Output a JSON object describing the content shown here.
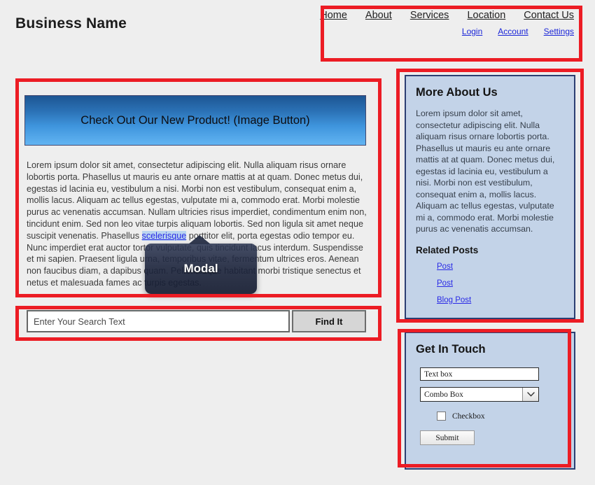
{
  "header": {
    "business_name": "Business Name"
  },
  "nav": {
    "primary": [
      {
        "label": "Home"
      },
      {
        "label": "About"
      },
      {
        "label": "Services"
      },
      {
        "label": "Location"
      },
      {
        "label": "Contact Us"
      }
    ],
    "secondary": [
      {
        "label": "Login"
      },
      {
        "label": "Account"
      },
      {
        "label": "Settings"
      }
    ]
  },
  "main": {
    "hero_button_label": "Check Out Our New Product! (Image Button)",
    "body_text_before_link": "Lorem ipsum dolor sit amet, consectetur adipiscing elit. Nulla aliquam risus ornare lobortis porta. Phasellus ut mauris eu ante ornare mattis at at quam. Donec metus dui, egestas id lacinia eu, vestibulum a nisi. Morbi non est vestibulum, consequat enim a, mollis lacus. Aliquam ac tellus egestas, vulputate mi a, commodo erat. Morbi molestie purus ac venenatis accumsan. Nullam ultricies risus imperdiet, condimentum enim non, tincidunt enim. Sed non leo vitae turpis aliquam lobortis. Sed non ligula sit amet neque suscipit venenatis. Phasellus ",
    "body_link_text": "scelerisque",
    "body_text_after_link": " porttitor elit, porta egestas odio tempor eu. Nunc imperdiet erat auctor tortor vulputate, quis tincidunt lacus interdum. Suspendisse et mi sapien. Praesent ligula urna, temporibus vitae, fermentum ultrices eros. Aenean non faucibus diam, a dapibus quam. Pellentesque habitant morbi tristique senectus et netus et malesuada fames ac turpis egestas."
  },
  "modal": {
    "label": "Modal"
  },
  "search": {
    "placeholder": "Enter Your Search Text",
    "value": "",
    "button_label": "Find It"
  },
  "sidebar": {
    "about": {
      "heading": "More About Us",
      "text": "Lorem ipsum dolor sit amet, consectetur adipiscing elit. Nulla aliquam risus ornare lobortis porta. Phasellus ut mauris eu ante ornare mattis at at quam. Donec metus dui, egestas id lacinia eu, vestibulum a nisi. Morbi non est vestibulum, consequat enim a, mollis lacus. Aliquam ac tellus egestas, vulputate mi a, commodo erat. Morbi molestie purus ac venenatis accumsan.",
      "related_heading": "Related Posts",
      "related_links": [
        {
          "label": "Post"
        },
        {
          "label": "Post"
        },
        {
          "label": "Blog Post"
        }
      ]
    },
    "contact": {
      "heading": "Get In Touch",
      "textbox_value": "Text box",
      "textbox_placeholder": "Text box",
      "combobox_value": "Combo Box",
      "checkbox_label": "Checkbox",
      "submit_label": "Submit"
    }
  },
  "colors": {
    "page_background": "#eeeeee",
    "annotation_red": "#ec1c24",
    "panel_blue": "#c3d3e8",
    "panel_border": "#2b3f72",
    "link_blue": "#2a2ae6",
    "hero_gradient_top": "#1d5693",
    "hero_gradient_bottom": "#62b4f2"
  }
}
